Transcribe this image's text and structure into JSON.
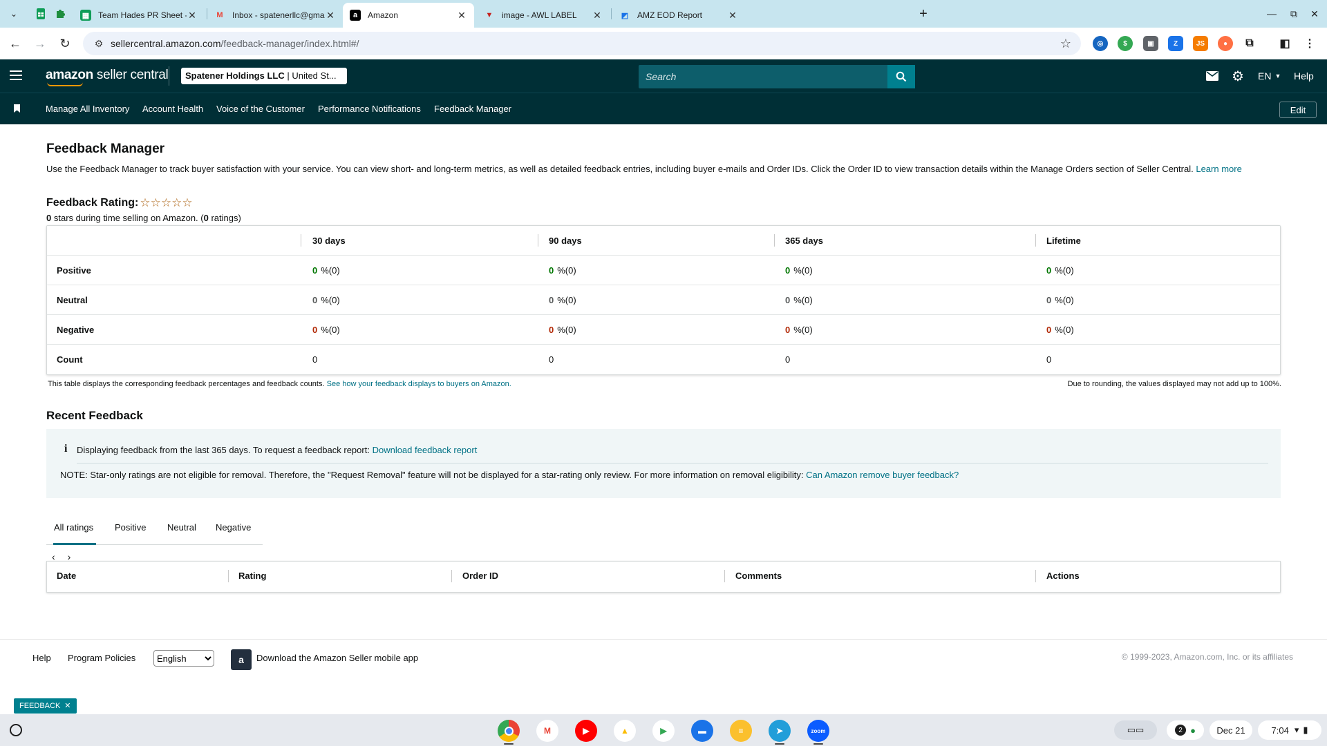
{
  "browser": {
    "tabs": [
      {
        "title": "Team Hades PR Sheet - Google",
        "icon": "sheets-icon",
        "color": "#0f9d58"
      },
      {
        "title": "Inbox - spatenerllc@gmail.com",
        "icon": "gmail-icon",
        "color": "#ea4335"
      },
      {
        "title": "Amazon",
        "icon": "amazon-icon",
        "color": "#000000"
      },
      {
        "title": "image - AWL LABEL",
        "icon": "awl-icon",
        "color": "#c5221f"
      },
      {
        "title": "AMZ EOD Report",
        "icon": "report-icon",
        "color": "#1a73e8"
      }
    ],
    "url_host": "sellercentral.amazon.com",
    "url_path": "/feedback-manager/index.html#/"
  },
  "header": {
    "logo_brand": "amazon",
    "logo_suffix": " seller central",
    "account_name": "Spatener Holdings LLC",
    "account_market": " | United St...",
    "search_placeholder": "Search",
    "language": "EN",
    "help": "Help"
  },
  "nav": {
    "items": [
      "Manage All Inventory",
      "Account Health",
      "Voice of the Customer",
      "Performance Notifications",
      "Feedback Manager"
    ],
    "edit": "Edit"
  },
  "page": {
    "title": "Feedback Manager",
    "description": "Use the Feedback Manager to track buyer satisfaction with your service. You can view short- and long-term metrics, as well as detailed feedback entries, including buyer e-mails and Order IDs. Click the Order ID to view transaction details within the Manage Orders section of Seller Central.",
    "learn_more": "Learn more",
    "rating_label": "Feedback Rating:",
    "stars": "☆☆☆☆☆",
    "rating_stars_count": "0",
    "rating_sub_mid": " stars during time selling on Amazon. (",
    "rating_count": "0",
    "rating_sub_end": " ratings)"
  },
  "feedback_table": {
    "columns": [
      "30 days",
      "90 days",
      "365 days",
      "Lifetime"
    ],
    "rows": [
      {
        "label": "Positive",
        "values": [
          "0",
          "0",
          "0",
          "0"
        ],
        "suffix": "%(0)"
      },
      {
        "label": "Neutral",
        "values": [
          "0",
          "0",
          "0",
          "0"
        ],
        "suffix": "%(0)"
      },
      {
        "label": "Negative",
        "values": [
          "0",
          "0",
          "0",
          "0"
        ],
        "suffix": "%(0)"
      },
      {
        "label": "Count",
        "values": [
          "0",
          "0",
          "0",
          "0"
        ]
      }
    ],
    "note": "This table displays the corresponding feedback percentages and feedback counts.",
    "note_link": "See how your feedback displays to buyers on Amazon.",
    "note_right": "Due to rounding, the values displayed may not add up to 100%."
  },
  "recent": {
    "title": "Recent Feedback",
    "info_line": "Displaying feedback from the last 365 days. To request a feedback report:",
    "info_link": "Download feedback report",
    "note": "NOTE: Star-only ratings are not eligible for removal. Therefore, the \"Request Removal\" feature will not be displayed for a star-rating only review. For more information on removal eligibility:",
    "note_link": "Can Amazon remove buyer feedback?",
    "tabs": [
      "All ratings",
      "Positive",
      "Neutral",
      "Negative"
    ],
    "columns": [
      "Date",
      "Rating",
      "Order ID",
      "Comments",
      "Actions"
    ]
  },
  "footer": {
    "help": "Help",
    "policies": "Program Policies",
    "language": "English",
    "app": "Download the Amazon Seller mobile app",
    "copyright": "© 1999-2023, Amazon.com, Inc. or its affiliates",
    "chip": "FEEDBACK"
  },
  "shelf": {
    "notifications": "2",
    "date": "Dec 21",
    "time": "7:04"
  },
  "colors": {
    "header_bg": "#002f36",
    "accent": "#007185",
    "positive": "#007600",
    "negative": "#b12704"
  }
}
